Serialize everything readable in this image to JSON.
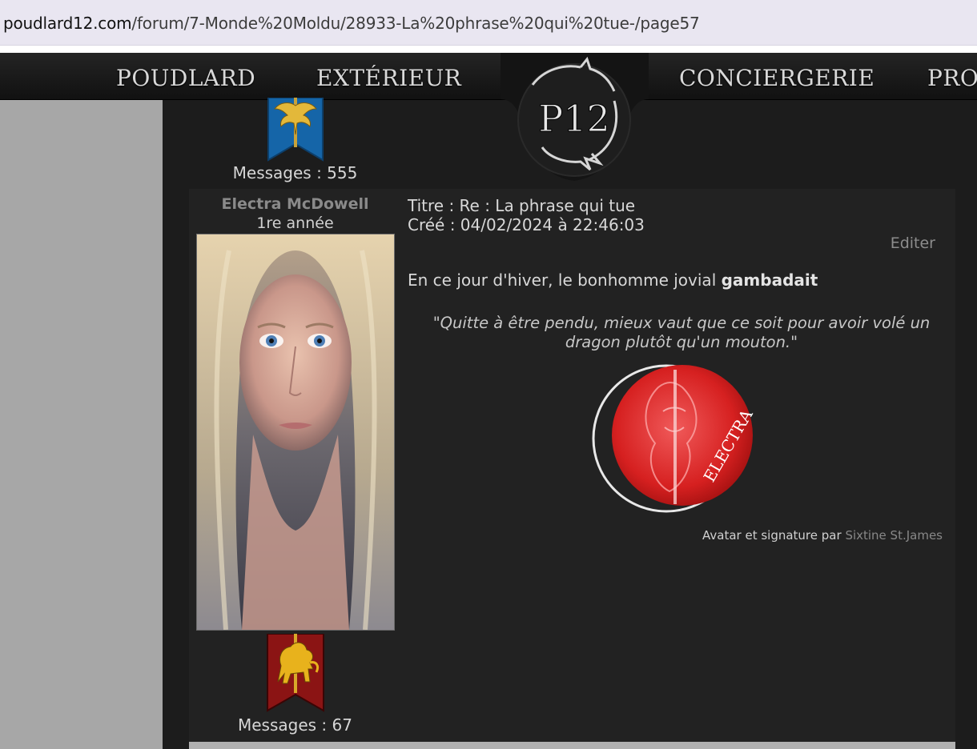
{
  "browser": {
    "url_domain": "poudlard12.com",
    "url_path": "/forum/7-Monde%20Moldu/28933-La%20phrase%20qui%20tue-/page57"
  },
  "nav": {
    "items": [
      "POUDLARD",
      "EXTÉRIEUR",
      "CONCIERGERIE",
      "PRO"
    ],
    "logo_text": "P12"
  },
  "previous_post": {
    "messages_label": "Messages : 555"
  },
  "post": {
    "author_name": "Electra McDowell",
    "author_rank": "1re année",
    "title_line": "Titre : Re : La phrase qui tue",
    "created_line": "Créé : 04/02/2024 à 22:46:03",
    "edit_label": "Editer",
    "body_prefix": "En ce jour d'hiver, le bonhomme jovial ",
    "body_bold": "gambadait",
    "signature_quote": "\"Quitte à être pendu, mieux vaut que ce soit pour avoir volé un dragon plutôt qu'un mouton.\"",
    "seal_text": "ELECTRA",
    "credit_prefix": "Avatar et signature par",
    "credit_name": "Sixtine St.James",
    "messages_label": "Messages : 67"
  },
  "colors": {
    "page_bg": "#a7a7a7",
    "content_bg": "#1c1c1c",
    "post_bg": "#222222",
    "house_red": "#8b1414",
    "house_gold": "#e8b21c",
    "ravenclaw_blue": "#1565a8",
    "seal_red": "#d62020"
  },
  "icons": {
    "rank_banner": "ravenclaw-eagle-banner-icon",
    "house_crest": "gryffindor-lion-banner-icon",
    "logo": "p12-dragon-logo-icon"
  }
}
